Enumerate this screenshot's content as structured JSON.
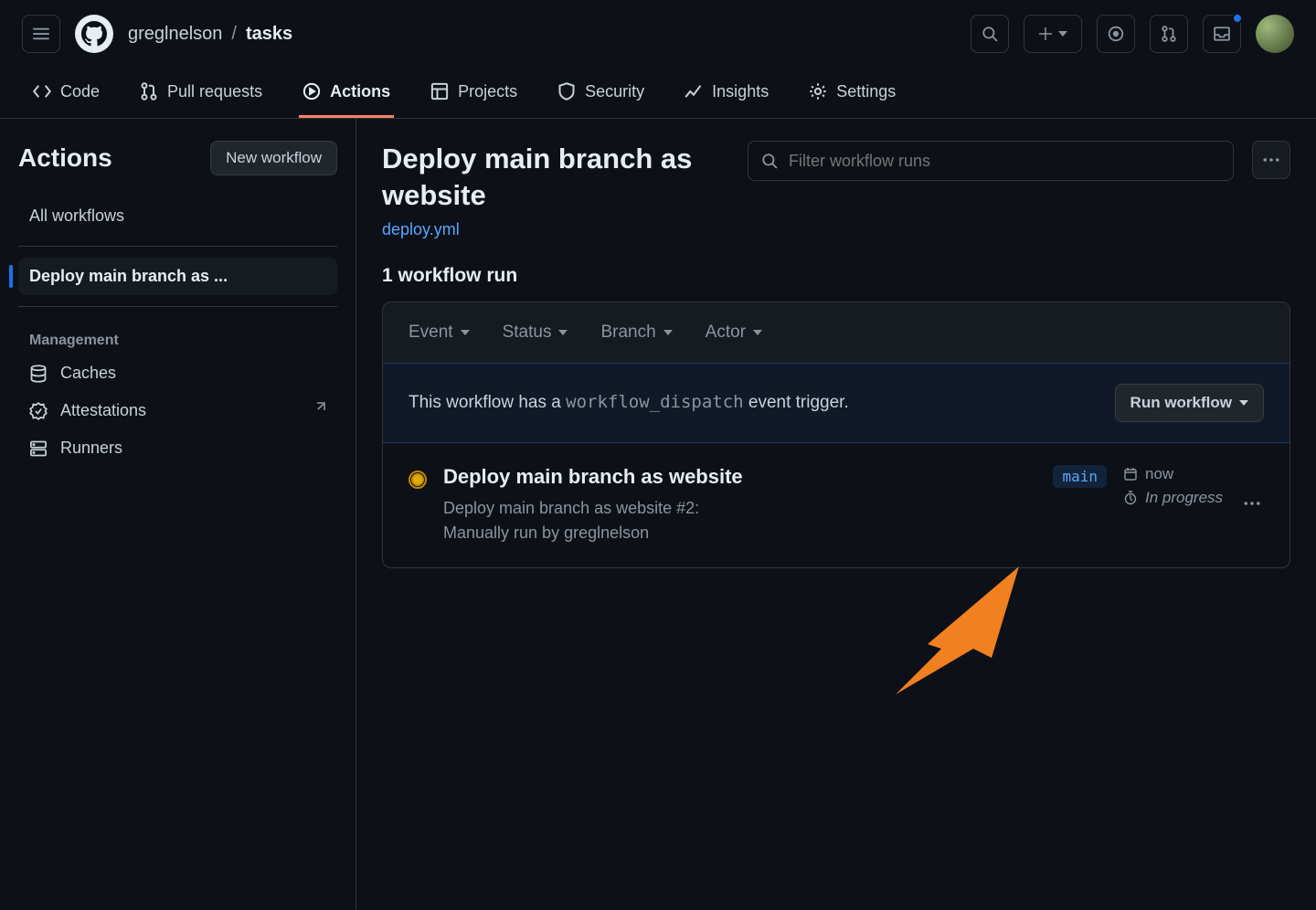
{
  "breadcrumb": {
    "owner": "greglnelson",
    "repo": "tasks"
  },
  "reponav": {
    "code": "Code",
    "pulls": "Pull requests",
    "actions": "Actions",
    "projects": "Projects",
    "security": "Security",
    "insights": "Insights",
    "settings": "Settings"
  },
  "sidebar": {
    "heading": "Actions",
    "new_workflow": "New workflow",
    "all_workflows": "All workflows",
    "selected": "Deploy main branch as ...",
    "management_label": "Management",
    "caches": "Caches",
    "attestations": "Attestations",
    "runners": "Runners"
  },
  "main": {
    "title": "Deploy main branch as website",
    "file": "deploy.yml",
    "search_placeholder": "Filter workflow runs",
    "runs_count": "1 workflow run",
    "filters": {
      "event": "Event",
      "status": "Status",
      "branch": "Branch",
      "actor": "Actor"
    },
    "dispatch": {
      "prefix": "This workflow has a ",
      "code": "workflow_dispatch",
      "suffix": " event trigger.",
      "button": "Run workflow"
    },
    "run": {
      "title": "Deploy main branch as website",
      "sub1": "Deploy main branch as website #2:",
      "sub2": "Manually run by greglnelson",
      "branch": "main",
      "time": "now",
      "status": "In progress"
    }
  }
}
